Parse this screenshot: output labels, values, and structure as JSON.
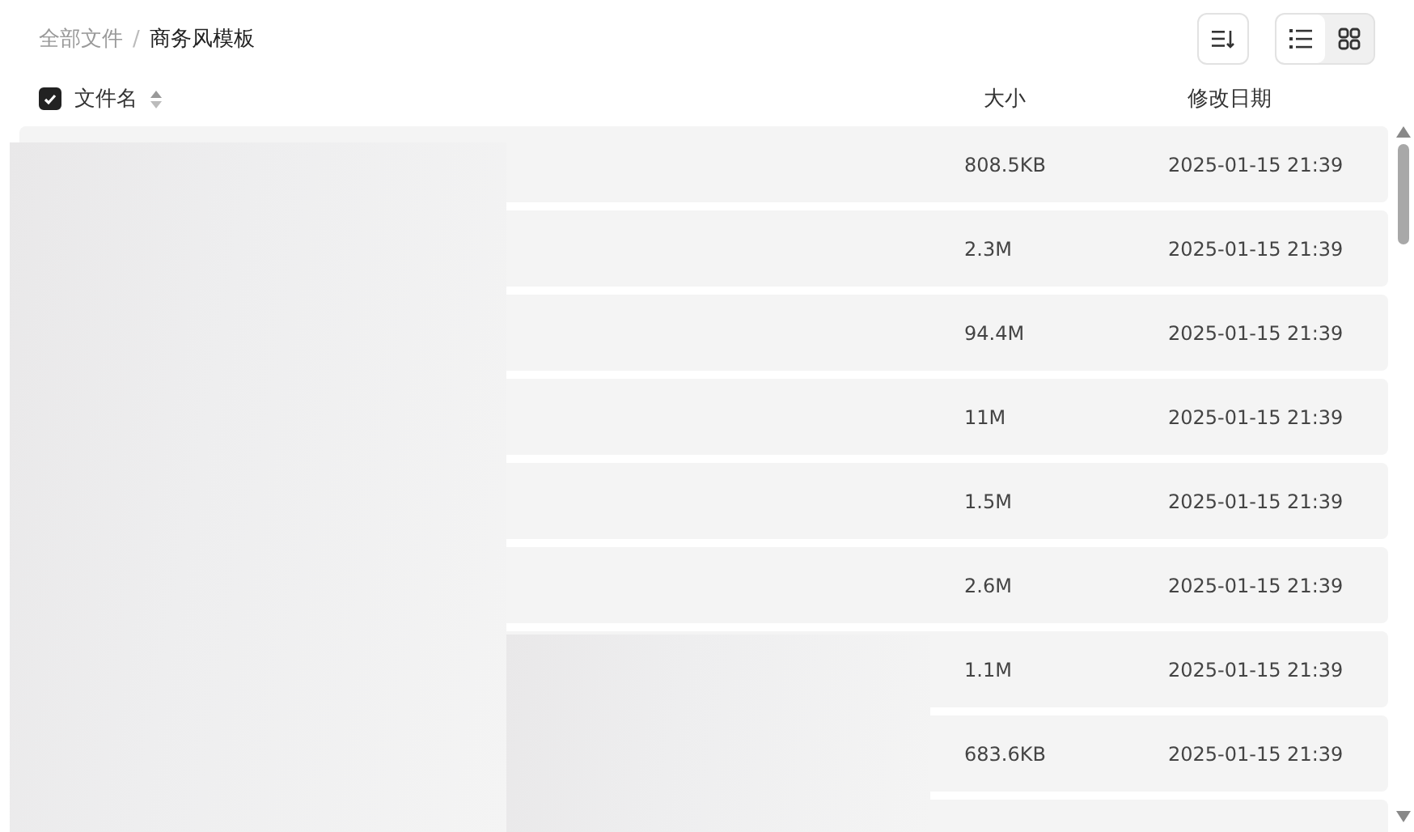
{
  "breadcrumb": [
    {
      "label": "全部文件",
      "current": false
    },
    {
      "label": "商务风模板",
      "current": true
    }
  ],
  "separator": "/",
  "view_modes": [
    {
      "kind": "list",
      "selected": true
    },
    {
      "kind": "grid",
      "selected": false
    }
  ],
  "table": {
    "select_all": {
      "checked": true
    },
    "columns": [
      "文件名",
      "大小",
      "修改日期"
    ],
    "rows": [
      {
        "size": "808.5KB",
        "modified": "2025-01-15 21:39"
      },
      {
        "size": "2.3M",
        "modified": "2025-01-15 21:39"
      },
      {
        "size": "94.4M",
        "modified": "2025-01-15 21:39"
      },
      {
        "size": "11M",
        "modified": "2025-01-15 21:39"
      },
      {
        "size": "1.5M",
        "modified": "2025-01-15 21:39"
      },
      {
        "size": "2.6M",
        "modified": "2025-01-15 21:39"
      },
      {
        "size": "1.1M",
        "modified": "2025-01-15 21:39"
      },
      {
        "size": "683.6KB",
        "modified": "2025-01-15 21:39"
      }
    ]
  }
}
